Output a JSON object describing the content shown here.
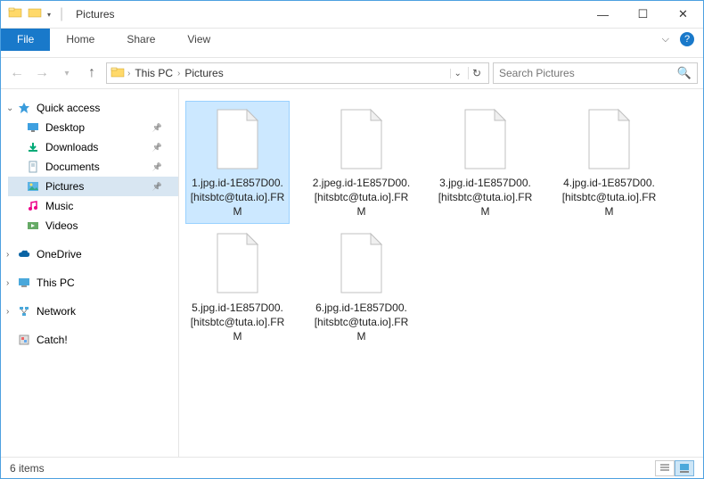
{
  "titlebar": {
    "title": "Pictures",
    "sep": "|"
  },
  "ribbon": {
    "file": "File",
    "home": "Home",
    "share": "Share",
    "view": "View",
    "help": "?"
  },
  "breadcrumb": {
    "thispc": "This PC",
    "folder": "Pictures"
  },
  "search": {
    "placeholder": "Search Pictures"
  },
  "sidebar": {
    "quick_access": "Quick access",
    "desktop": "Desktop",
    "downloads": "Downloads",
    "documents": "Documents",
    "pictures": "Pictures",
    "music": "Music",
    "videos": "Videos",
    "onedrive": "OneDrive",
    "thispc": "This PC",
    "network": "Network",
    "catch": "Catch!"
  },
  "files": [
    {
      "name": "1.jpg.id-1E857D00.[hitsbtc@tuta.io].FRM",
      "selected": true
    },
    {
      "name": "2.jpeg.id-1E857D00.[hitsbtc@tuta.io].FRM",
      "selected": false
    },
    {
      "name": "3.jpg.id-1E857D00.[hitsbtc@tuta.io].FRM",
      "selected": false
    },
    {
      "name": "4.jpg.id-1E857D00.[hitsbtc@tuta.io].FRM",
      "selected": false
    },
    {
      "name": "5.jpg.id-1E857D00.[hitsbtc@tuta.io].FRM",
      "selected": false
    },
    {
      "name": "6.jpg.id-1E857D00.[hitsbtc@tuta.io].FRM",
      "selected": false
    }
  ],
  "statusbar": {
    "count": "6 items"
  }
}
